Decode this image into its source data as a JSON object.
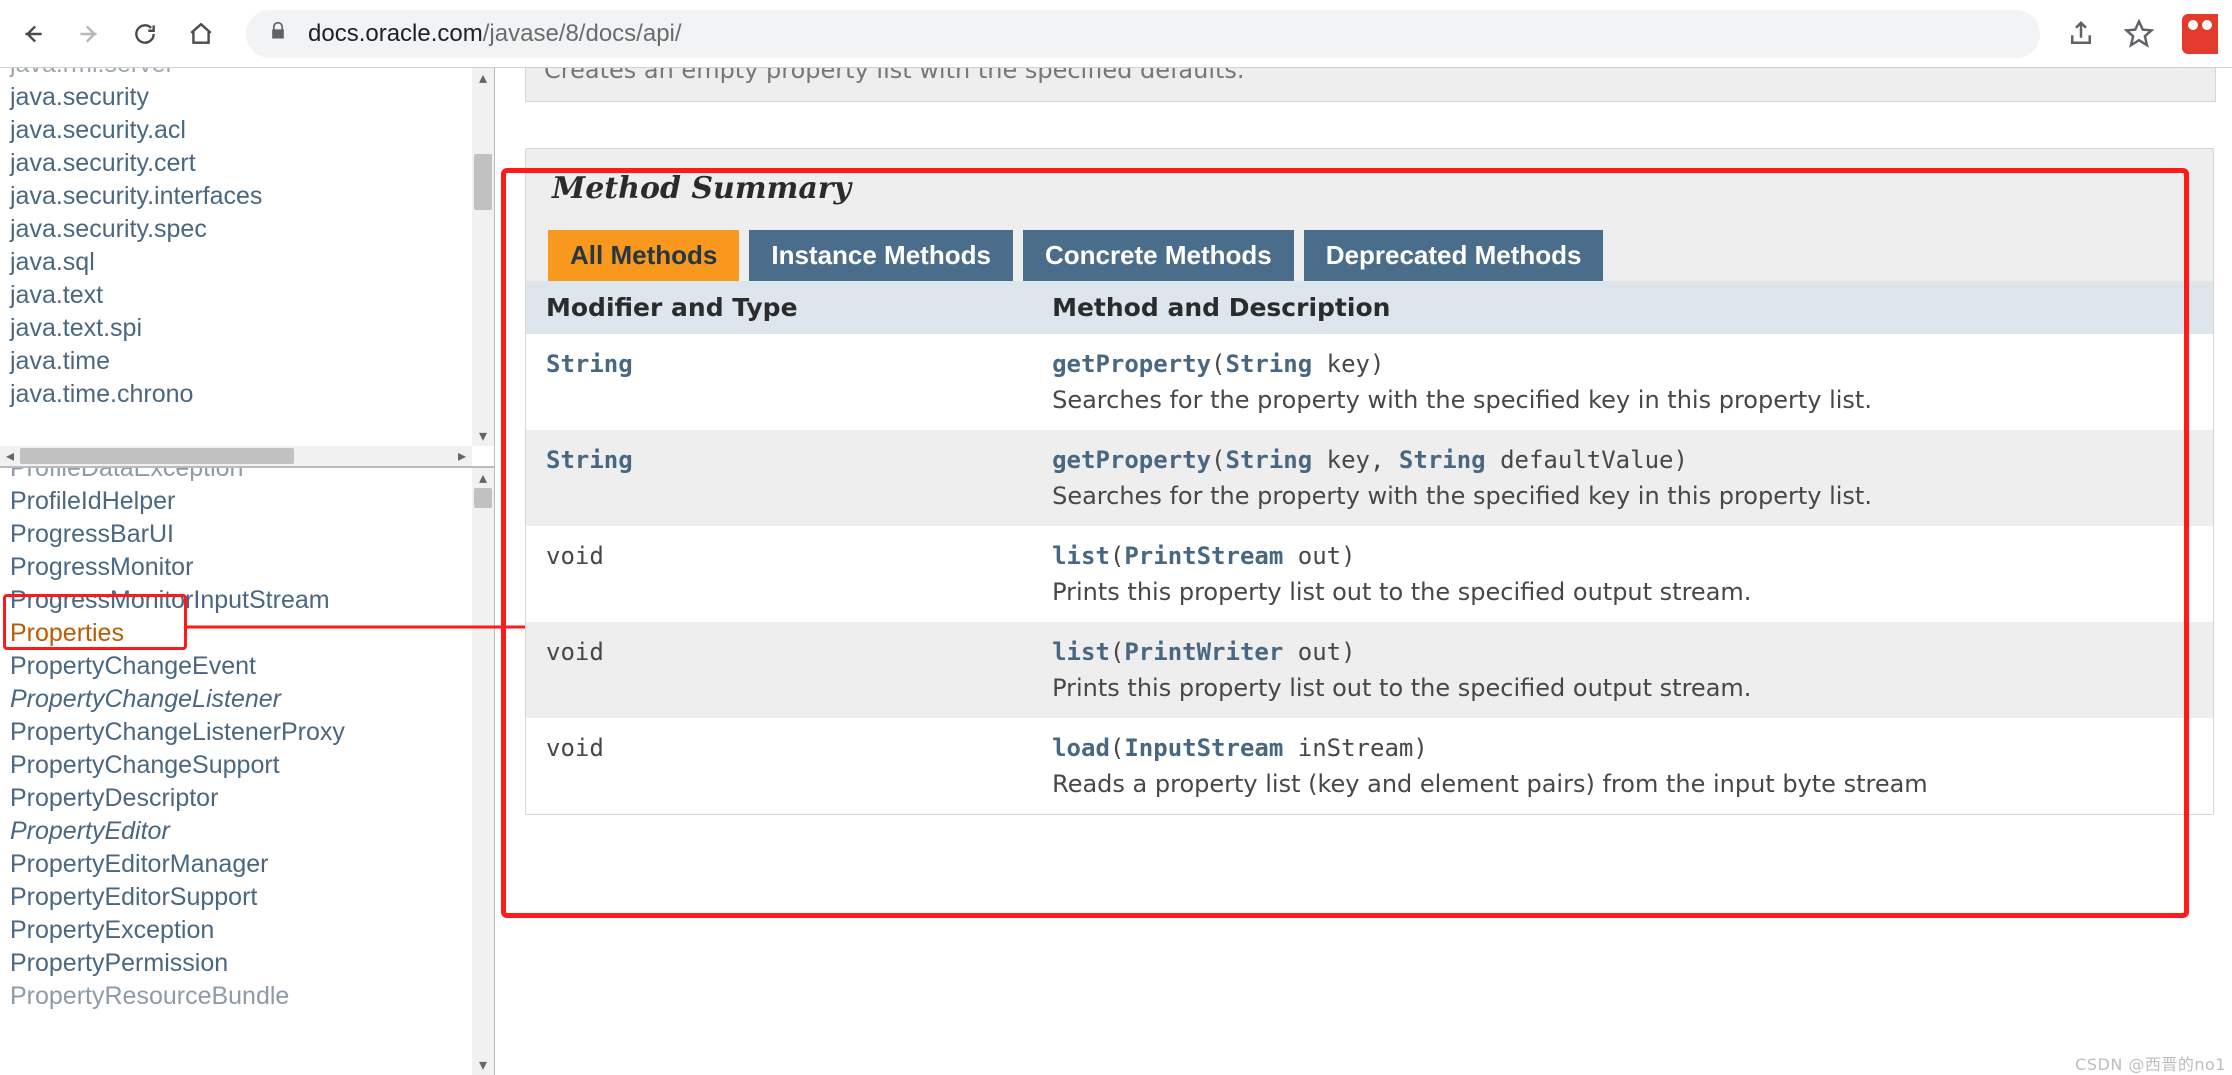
{
  "browser": {
    "url_host": "docs.oracle.com",
    "url_path": "/javase/8/docs/api/"
  },
  "packages_top_cut": "java.rmi.server",
  "packages": [
    "java.security",
    "java.security.acl",
    "java.security.cert",
    "java.security.interfaces",
    "java.security.spec",
    "java.sql",
    "java.text",
    "java.text.spi",
    "java.time",
    "java.time.chrono"
  ],
  "classes_top_cut": "ProfileDataException",
  "classes": [
    {
      "name": "ProfileIdHelper",
      "italic": false
    },
    {
      "name": "ProgressBarUI",
      "italic": false
    },
    {
      "name": "ProgressMonitor",
      "italic": false
    },
    {
      "name": "ProgressMonitorInputStream",
      "italic": false
    },
    {
      "name": "Properties",
      "italic": false,
      "selected": true
    },
    {
      "name": "PropertyChangeEvent",
      "italic": false
    },
    {
      "name": "PropertyChangeListener",
      "italic": true
    },
    {
      "name": "PropertyChangeListenerProxy",
      "italic": false
    },
    {
      "name": "PropertyChangeSupport",
      "italic": false
    },
    {
      "name": "PropertyDescriptor",
      "italic": false
    },
    {
      "name": "PropertyEditor",
      "italic": true
    },
    {
      "name": "PropertyEditorManager",
      "italic": false
    },
    {
      "name": "PropertyEditorSupport",
      "italic": false
    },
    {
      "name": "PropertyException",
      "italic": false
    },
    {
      "name": "PropertyPermission",
      "italic": false
    }
  ],
  "classes_bottom_cut": "PropertyResourceBundle",
  "ctor_fragment": "Creates an empty property list with the specified defaults.",
  "section_title": "Method Summary",
  "tabs": [
    "All Methods",
    "Instance Methods",
    "Concrete Methods",
    "Deprecated Methods"
  ],
  "active_tab": 0,
  "table_headers": [
    "Modifier and Type",
    "Method and Description"
  ],
  "methods": [
    {
      "return": "String",
      "void": false,
      "name": "getProperty",
      "params": [
        {
          "type": "String",
          "name": "key"
        }
      ],
      "desc": "Searches for the property with the specified key in this property list."
    },
    {
      "return": "String",
      "void": false,
      "name": "getProperty",
      "params": [
        {
          "type": "String",
          "name": "key"
        },
        {
          "type": "String",
          "name": "defaultValue"
        }
      ],
      "desc": "Searches for the property with the specified key in this property list."
    },
    {
      "return": "void",
      "void": true,
      "name": "list",
      "params": [
        {
          "type": "PrintStream",
          "name": "out"
        }
      ],
      "desc": "Prints this property list out to the specified output stream."
    },
    {
      "return": "void",
      "void": true,
      "name": "list",
      "params": [
        {
          "type": "PrintWriter",
          "name": "out"
        }
      ],
      "desc": "Prints this property list out to the specified output stream."
    },
    {
      "return": "void",
      "void": true,
      "name": "load",
      "params": [
        {
          "type": "InputStream",
          "name": "inStream"
        }
      ],
      "desc": "Reads a property list (key and element pairs) from the input byte stream"
    }
  ],
  "watermark": "CSDN @西晋的no1",
  "colors": {
    "accent_orange": "#f8991d",
    "tab_blue": "#4a6d8c",
    "link": "#4a6782",
    "annotate_red": "#ff1a1a"
  }
}
